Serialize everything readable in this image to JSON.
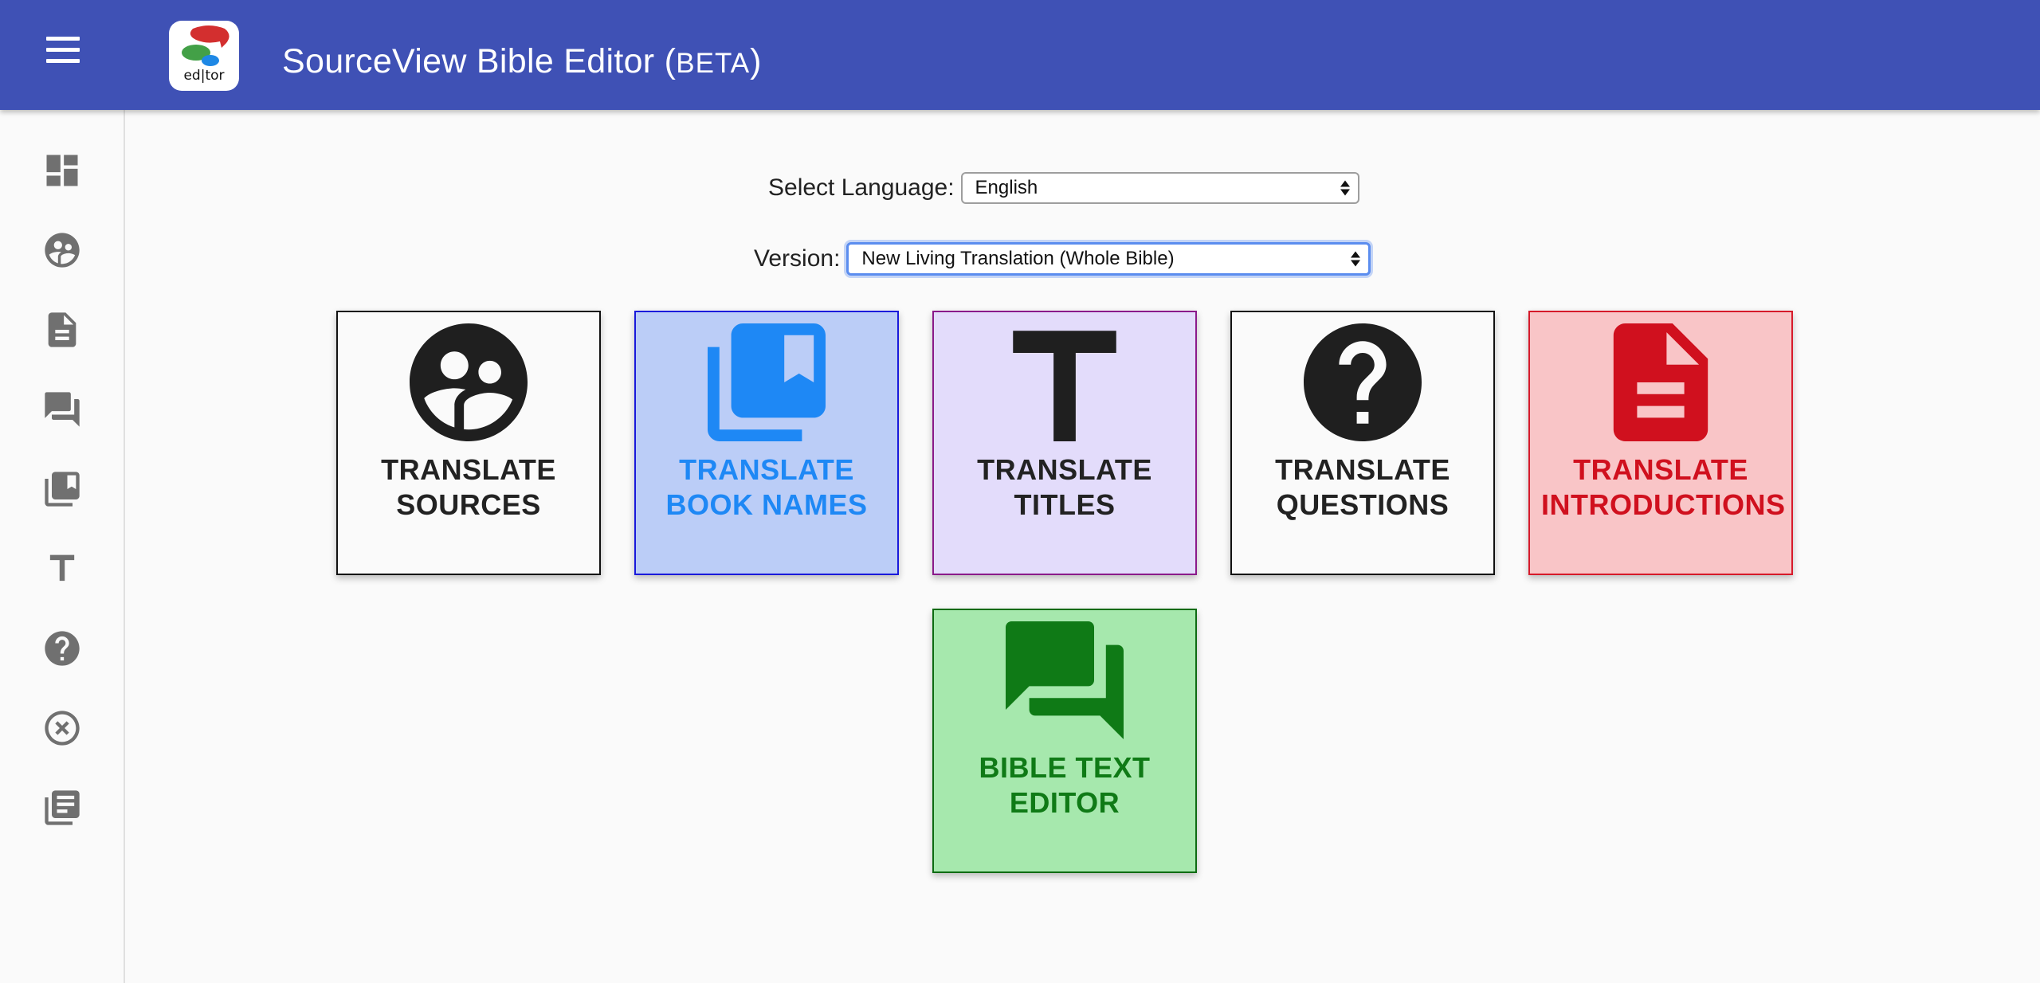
{
  "header": {
    "title": "SourceView Bible Editor (",
    "beta": "BETA",
    "title_close": ")",
    "logo_text": "ed|tor"
  },
  "sidebar": {
    "items": [
      {
        "icon": "dashboard-icon"
      },
      {
        "icon": "translate-sources-icon"
      },
      {
        "icon": "document-icon"
      },
      {
        "icon": "forum-icon"
      },
      {
        "icon": "library-books-icon"
      },
      {
        "icon": "title-icon"
      },
      {
        "icon": "help-icon"
      },
      {
        "icon": "cancel-icon"
      },
      {
        "icon": "article-list-icon"
      }
    ]
  },
  "form": {
    "language_label": "Select Language:",
    "language_value": "English",
    "version_label": "Version:",
    "version_value": "New Living Translation (Whole Bible)"
  },
  "tiles": [
    {
      "line1": "TRANSLATE",
      "line2": "SOURCES",
      "icon": "translate-sources-icon",
      "bg": "#fafafa",
      "border": "#111111",
      "color": "#222222"
    },
    {
      "line1": "TRANSLATE",
      "line2": "BOOK NAMES",
      "icon": "library-books-icon",
      "bg": "#bbcdf7",
      "border": "#1a1adb",
      "color": "#1e88f5"
    },
    {
      "line1": "TRANSLATE",
      "line2": "TITLES",
      "icon": "title-icon",
      "bg": "#e3dcfb",
      "border": "#8a1a8a",
      "color": "#222222"
    },
    {
      "line1": "TRANSLATE",
      "line2": "QUESTIONS",
      "icon": "help-icon",
      "bg": "#fafafa",
      "border": "#111111",
      "color": "#222222"
    },
    {
      "line1": "TRANSLATE",
      "line2": "INTRODUCTIONS",
      "icon": "document-icon",
      "bg": "#f9c5c7",
      "border": "#d61a2a",
      "color": "#d0101e"
    },
    {
      "line1": "BIBLE TEXT",
      "line2": "EDITOR",
      "icon": "forum-icon",
      "bg": "#a6e8ad",
      "border": "#0d6b12",
      "color": "#0f7a16"
    }
  ]
}
